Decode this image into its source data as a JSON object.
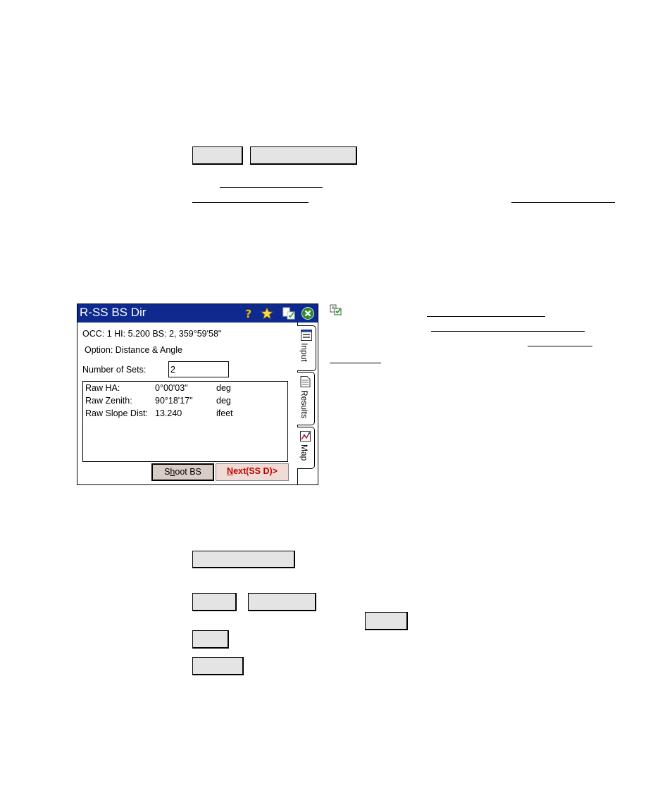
{
  "window": {
    "title": "R-SS BS Dir",
    "info_line": "OCC: 1  HI: 5.200  BS: 2, 359°59'58\"",
    "option_line": "Option: Distance & Angle",
    "sets_label": "Number of Sets:",
    "sets_value": "2",
    "observations": [
      {
        "label": "Raw HA:",
        "value": "0°00'03\"",
        "unit": "deg"
      },
      {
        "label": "Raw Zenith:",
        "value": "90°18'17\"",
        "unit": "deg"
      },
      {
        "label": "Raw Slope Dist:",
        "value": "13.240",
        "unit": "ifeet"
      }
    ],
    "shoot_button": {
      "prefix": "S",
      "mnemonic": "h",
      "rest": "oot BS"
    },
    "next_button": {
      "mnemonic": "N",
      "rest": "ext(SS D)>"
    },
    "tabs": [
      "Input",
      "Results",
      "Map"
    ],
    "icons": [
      "help-icon",
      "favorites-star-icon",
      "settings-check-icon",
      "close-icon"
    ]
  },
  "colors": {
    "titlebar": "#0e2a8f",
    "next_text": "#c00000",
    "shoot_bg": "#d8ccc4"
  }
}
